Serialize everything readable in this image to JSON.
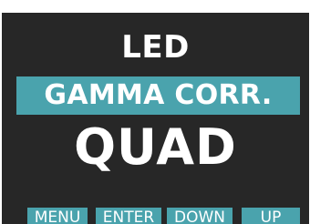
{
  "display": {
    "section_title": "LED",
    "parameter": "GAMMA CORR.",
    "value": "QUAD"
  },
  "softkeys": [
    {
      "label": "MENU"
    },
    {
      "label": "ENTER"
    },
    {
      "label": "DOWN"
    },
    {
      "label": "UP"
    }
  ],
  "colors": {
    "screen_background": "#272727",
    "accent": "#4aa3ad",
    "text": "#ffffff",
    "page_background": "#ffffff"
  }
}
